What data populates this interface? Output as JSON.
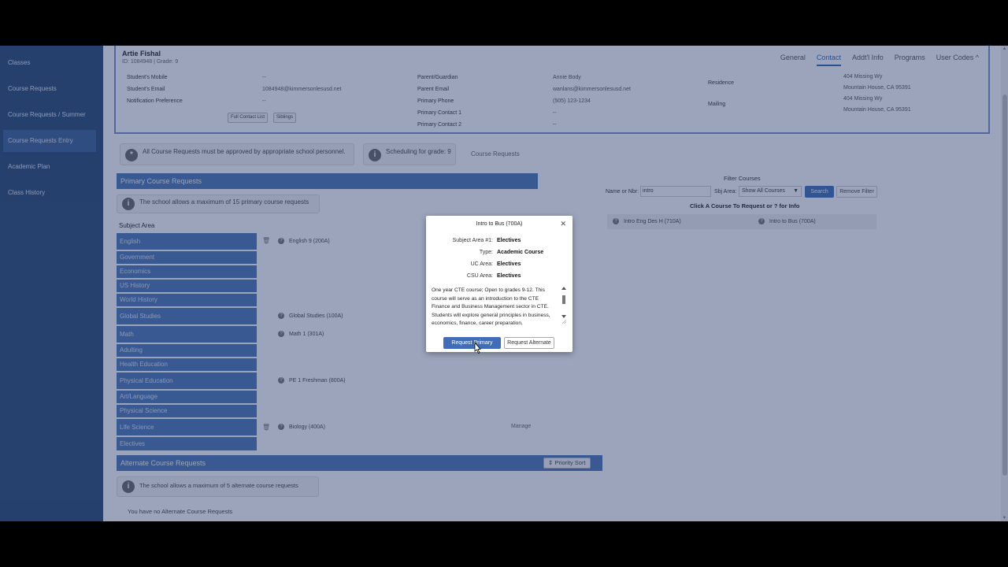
{
  "sidebar": {
    "items": [
      {
        "label": "Classes"
      },
      {
        "label": "Course Requests"
      },
      {
        "label": "Course Requests / Summer"
      },
      {
        "label": "Course Requests Entry"
      },
      {
        "label": "Academic Plan"
      },
      {
        "label": "Class History"
      }
    ]
  },
  "student": {
    "name": "Artie Fishal",
    "id_line": "ID: 1084948 | Grade: 9",
    "tabs": [
      "General",
      "Contact",
      "Addt'l Info",
      "Programs",
      "User Codes"
    ],
    "contact": {
      "mobile_label": "Student's Mobile",
      "mobile_value": "--",
      "email_label": "Student's Email",
      "email_value": "1084948@kimmersonlesusd.net",
      "notif_label": "Notification Preference",
      "notif_value": "--",
      "parent_label": "Parent/Guardian",
      "parent_value": "Annie Body",
      "parent_email_label": "Parent Email",
      "parent_email_value": "wanlans@kimmersonlesusd.net",
      "phone_label": "Primary Phone",
      "phone_value": "(505) 123-1234",
      "contact1_label": "Primary Contact 1",
      "contact1_value": "--",
      "contact2_label": "Primary Contact 2",
      "contact2_value": "--",
      "residence_label": "Residence",
      "residence_line1": "404 Missing Wy",
      "residence_line2": "Mountain House, CA 95391",
      "mailing_label": "Mailing",
      "mailing_line1": "404 Missing Wy",
      "mailing_line2": "Mountain House, CA 95391",
      "full_contact_btn": "Full Contact List",
      "siblings_btn": "Siblings"
    }
  },
  "alerts": {
    "approval": "All Course Requests must be approved by appropriate school personnel.",
    "scheduling": "Scheduling for grade: 9",
    "course_requests_label": "Course Requests"
  },
  "primary": {
    "header": "Primary Course Requests",
    "max_note": "The school allows a maximum of 15 primary course requests",
    "subject_area_label": "Subject Area",
    "subjects": [
      "English",
      "Government",
      "Economics",
      "US History",
      "World History",
      "Global Studies",
      "Math",
      "Adulting",
      "Health Education",
      "Physical Education",
      "Art/Language",
      "Physical Science",
      "Life Science",
      "Electives"
    ],
    "courses": [
      {
        "label": "English 9 (200A)"
      },
      {
        "label": "Global Studies (100A)"
      },
      {
        "label": "Math 1 (301A)"
      },
      {
        "label": "PE 1 Freshman (800A)"
      },
      {
        "label": "Biology (400A)"
      }
    ],
    "manage_label": "Manage"
  },
  "alternate": {
    "header": "Alternate Course Requests",
    "priority_sort": "Priority Sort",
    "max_note": "The school allows a maximum of 5 alternate course requests",
    "none_note": "You have no Alternate Course Requests"
  },
  "filter": {
    "title": "Filter Courses",
    "name_label": "Name or Nbr:",
    "name_value": "intro",
    "sbj_label": "Sbj Area:",
    "sbj_value": "Show All Courses",
    "search_btn": "Search",
    "remove_btn": "Remove Filter",
    "click_note": "Click A Course To Request or ? for Info",
    "results": [
      "Intro Eng Des H (710A)",
      "Intro to Bus (700A)"
    ]
  },
  "modal": {
    "title": "Intro to Bus (700A)",
    "rows": [
      {
        "label": "Subject Area #1:",
        "value": "Electives"
      },
      {
        "label": "Type:",
        "value": "Academic Course"
      },
      {
        "label": "UC Area:",
        "value": "Electives"
      },
      {
        "label": "CSU Area:",
        "value": "Electives"
      }
    ],
    "description": "One year CTE course; Open to grades 9-12. This course will serve as an introduction to the CTE Finance and Business Management sector in CTE. Students will explore general principles in business, economics, finance, career preparation,",
    "request_primary": "Request Primary",
    "request_alternate": "Request Alternate"
  }
}
